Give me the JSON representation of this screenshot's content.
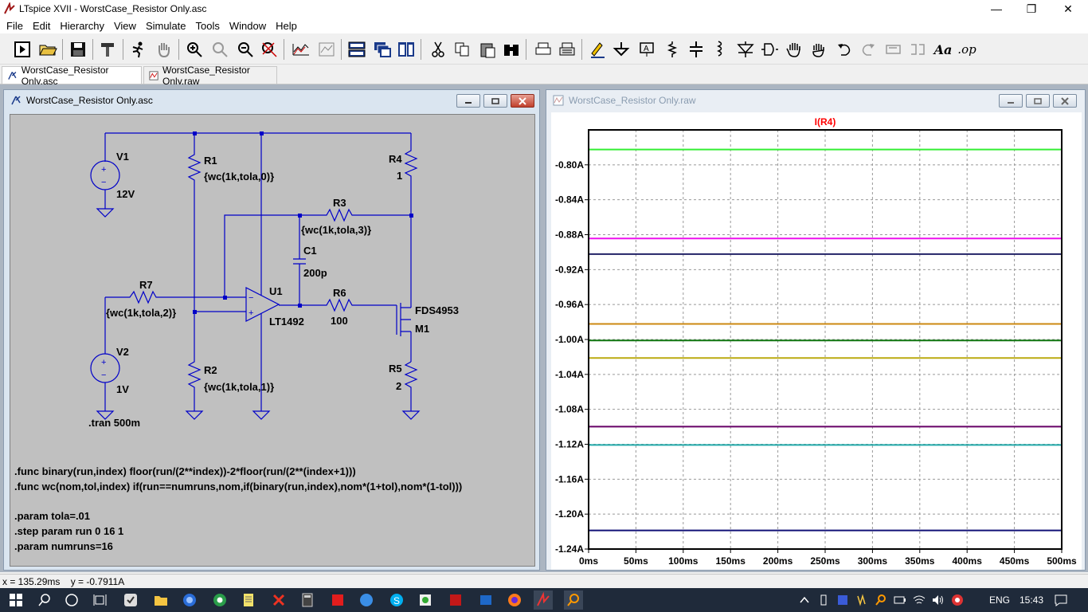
{
  "window": {
    "title": "LTspice XVII - WorstCase_Resistor Only.asc",
    "controls": {
      "minimize": "—",
      "maximize": "❐",
      "close": "✕"
    }
  },
  "menu": [
    "File",
    "Edit",
    "Hierarchy",
    "View",
    "Simulate",
    "Tools",
    "Window",
    "Help"
  ],
  "toolbar": {
    "op_label": ".op",
    "text_label": "Aa"
  },
  "tabs": [
    {
      "label": "WorstCase_Resistor Only.asc",
      "active": true
    },
    {
      "label": "WorstCase_Resistor Only.raw",
      "active": false
    }
  ],
  "schematic": {
    "title": "WorstCase_Resistor Only.asc",
    "labels": {
      "v1": "V1",
      "v1_value": "12V",
      "r1": "R1",
      "r1_value": "{wc(1k,tola,0)}",
      "r4": "R4",
      "r4_value": "1",
      "r3": "R3",
      "r3_value": "{wc(1k,tola,3)}",
      "c1": "C1",
      "c1_value": "200p",
      "r7": "R7",
      "r7_value": "{wc(1k,tola,2)}",
      "u1": "U1",
      "u1_value": "LT1492",
      "r6": "R6",
      "r6_value": "100",
      "m1_value": "FDS4953",
      "m1": "M1",
      "v2": "V2",
      "v2_value": "1V",
      "r2": "R2",
      "r2_value": "{wc(1k,tola,1)}",
      "r5": "R5",
      "r5_value": "2",
      "plus": "+",
      "minus": "−"
    },
    "directives": [
      ".tran 500m",
      ".func binary(run,index) floor(run/(2**index))-2*floor(run/(2**(index+1)))",
      ".func wc(nom,tol,index) if(run==numruns,nom,if(binary(run,index),nom*(1+tol),nom*(1-tol)))",
      ".param tola=.01",
      ".step param run 0 16 1",
      ".param numruns=16"
    ]
  },
  "plot": {
    "title": "WorstCase_Resistor Only.raw"
  },
  "chart_data": {
    "type": "line",
    "title": "I(R4)",
    "title_color": "#ff0000",
    "xlabel": "",
    "ylabel": "",
    "xlim": [
      0,
      500
    ],
    "ylim": [
      -1.24,
      -0.76
    ],
    "x_ticks": [
      "0ms",
      "50ms",
      "100ms",
      "150ms",
      "200ms",
      "250ms",
      "300ms",
      "350ms",
      "400ms",
      "450ms",
      "500ms"
    ],
    "x_tick_values": [
      0,
      50,
      100,
      150,
      200,
      250,
      300,
      350,
      400,
      450,
      500
    ],
    "y_ticks": [
      "-0.80A",
      "-0.84A",
      "-0.88A",
      "-0.92A",
      "-0.96A",
      "-1.00A",
      "-1.04A",
      "-1.08A",
      "-1.12A",
      "-1.16A",
      "-1.20A",
      "-1.24A"
    ],
    "y_tick_values": [
      -0.8,
      -0.84,
      -0.88,
      -0.92,
      -0.96,
      -1.0,
      -1.04,
      -1.08,
      -1.12,
      -1.16,
      -1.2,
      -1.24
    ],
    "grid": true,
    "series": [
      {
        "color": "#33ee33",
        "x": [
          0,
          500
        ],
        "values": [
          -0.7825,
          -0.7825
        ]
      },
      {
        "color": "#ee11ee",
        "x": [
          0,
          500
        ],
        "values": [
          -0.8843,
          -0.8843
        ]
      },
      {
        "color": "#222266",
        "x": [
          0,
          500
        ],
        "values": [
          -0.9023,
          -0.9023
        ]
      },
      {
        "color": "#cc8811",
        "x": [
          0,
          500
        ],
        "values": [
          -0.9822,
          -0.9822
        ]
      },
      {
        "color": "#117711",
        "x": [
          0,
          500
        ],
        "values": [
          -1.0011,
          -1.0011
        ]
      },
      {
        "color": "#bbaa11",
        "x": [
          0,
          500
        ],
        "values": [
          -1.0212,
          -1.0212
        ]
      },
      {
        "color": "#660066",
        "x": [
          0,
          500
        ],
        "values": [
          -1.0998,
          -1.0998
        ]
      },
      {
        "color": "#22aaaa",
        "x": [
          0,
          500
        ],
        "values": [
          -1.1208,
          -1.1208
        ]
      },
      {
        "color": "#111177",
        "x": [
          0,
          500
        ],
        "values": [
          -1.2187,
          -1.2187
        ]
      }
    ]
  },
  "status": {
    "coords": "x = 135.29ms    y = -0.7911A"
  },
  "taskbar": {
    "language": "ENG",
    "time": "15:43"
  }
}
